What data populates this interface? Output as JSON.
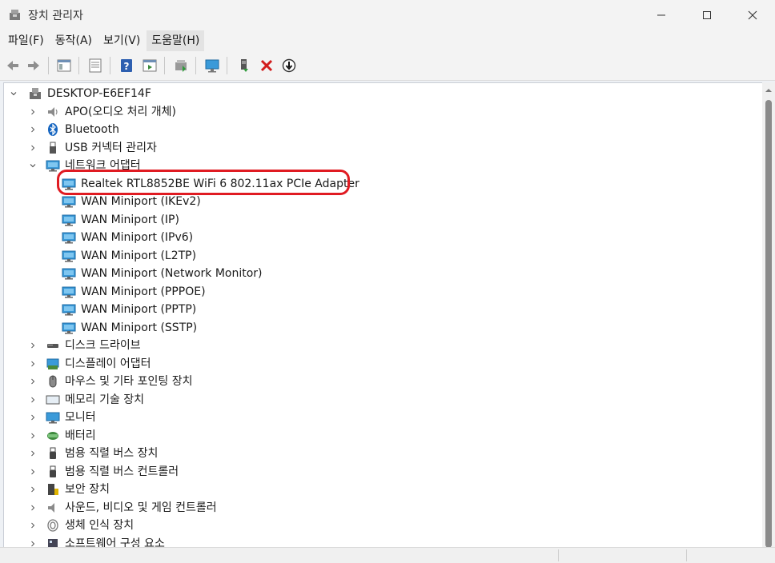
{
  "window": {
    "title": "장치 관리자",
    "controls": [
      "minimize",
      "maximize",
      "close"
    ]
  },
  "menu": [
    {
      "label": "파일(F)"
    },
    {
      "label": "동작(A)"
    },
    {
      "label": "보기(V)"
    },
    {
      "label": "도움말(H)"
    }
  ],
  "toolbar": {
    "buttons": [
      "back-icon",
      "forward-icon",
      "show-hide-console-tree-icon",
      "properties-icon",
      "help-icon",
      "action-pane-icon",
      "update-driver-icon",
      "scan-hardware-icon",
      "enable-device-icon",
      "uninstall-device-icon",
      "disable-device-icon"
    ]
  },
  "tree": {
    "root": {
      "label": "DESKTOP-E6EF14F",
      "expanded": true
    },
    "categories": [
      {
        "label": "APO(오디오 처리 개체)",
        "icon": "speaker-icon"
      },
      {
        "label": "Bluetooth",
        "icon": "bluetooth-icon"
      },
      {
        "label": "USB 커넥터 관리자",
        "icon": "usb-icon"
      },
      {
        "label": "네트워크 어댑터",
        "icon": "network-adapter-icon",
        "expanded": true,
        "children": [
          {
            "label": "Realtek RTL8852BE WiFi 6 802.11ax PCIe Adapter",
            "highlighted": true
          },
          {
            "label": "WAN Miniport (IKEv2)"
          },
          {
            "label": "WAN Miniport (IP)"
          },
          {
            "label": "WAN Miniport (IPv6)"
          },
          {
            "label": "WAN Miniport (L2TP)"
          },
          {
            "label": "WAN Miniport (Network Monitor)"
          },
          {
            "label": "WAN Miniport (PPPOE)"
          },
          {
            "label": "WAN Miniport (PPTP)"
          },
          {
            "label": "WAN Miniport (SSTP)"
          }
        ]
      },
      {
        "label": "디스크 드라이브",
        "icon": "disk-drive-icon"
      },
      {
        "label": "디스플레이 어댑터",
        "icon": "display-adapter-icon"
      },
      {
        "label": "마우스 및 기타 포인팅 장치",
        "icon": "mouse-icon"
      },
      {
        "label": "메모리 기술 장치",
        "icon": "memory-icon"
      },
      {
        "label": "모니터",
        "icon": "monitor-icon"
      },
      {
        "label": "배터리",
        "icon": "battery-icon"
      },
      {
        "label": "범용 직렬 버스 장치",
        "icon": "usb-device-icon"
      },
      {
        "label": "범용 직렬 버스 컨트롤러",
        "icon": "usb-controller-icon"
      },
      {
        "label": "보안 장치",
        "icon": "security-device-icon"
      },
      {
        "label": "사운드, 비디오 및 게임 컨트롤러",
        "icon": "sound-icon"
      },
      {
        "label": "생체 인식 장치",
        "icon": "fingerprint-icon"
      },
      {
        "label": "소프트웨어 구성 요소",
        "icon": "software-component-icon"
      }
    ]
  },
  "colors": {
    "highlight_ring": "#e01b22",
    "adapter_icon": "#3a9ad9"
  }
}
